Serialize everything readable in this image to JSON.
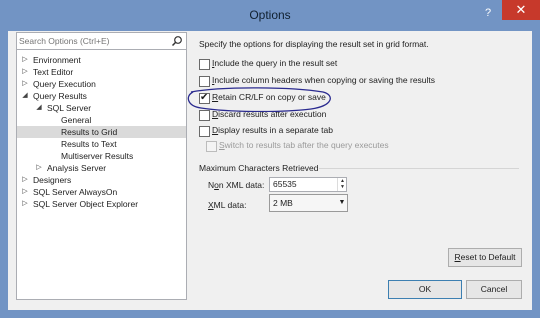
{
  "window": {
    "title": "Options",
    "help_glyph": "?",
    "close_glyph": "✕"
  },
  "search": {
    "placeholder": "Search Options (Ctrl+E)"
  },
  "tree": {
    "items": [
      {
        "label": "Environment",
        "expander": "▷"
      },
      {
        "label": "Text Editor",
        "expander": "▷"
      },
      {
        "label": "Query Execution",
        "expander": "▷"
      },
      {
        "label": "Query Results",
        "expander": "◢"
      },
      {
        "label": "SQL Server",
        "expander": "◢"
      },
      {
        "label": "General",
        "expander": ""
      },
      {
        "label": "Results to Grid",
        "expander": "",
        "selected": true
      },
      {
        "label": "Results to Text",
        "expander": ""
      },
      {
        "label": "Multiserver Results",
        "expander": ""
      },
      {
        "label": "Analysis Server",
        "expander": "▷"
      },
      {
        "label": "Designers",
        "expander": "▷"
      },
      {
        "label": "SQL Server AlwaysOn",
        "expander": "▷"
      },
      {
        "label": "SQL Server Object Explorer",
        "expander": "▷"
      }
    ]
  },
  "panel": {
    "description": "Specify the options for displaying the result set in grid format.",
    "options": [
      {
        "key": "I",
        "rest": "nclude the query in the result set",
        "checked": false,
        "enabled": true
      },
      {
        "key": "I",
        "rest": "nclude column headers when copying or saving the results",
        "checked": false,
        "enabled": true
      },
      {
        "key": "R",
        "rest": "etain CR/LF on copy or save",
        "checked": true,
        "enabled": true
      },
      {
        "key": "D",
        "rest": "iscard results after execution",
        "checked": false,
        "enabled": true
      },
      {
        "key": "D",
        "rest": "isplay results in a separate tab",
        "checked": false,
        "enabled": true
      },
      {
        "key": "S",
        "rest": "witch to results tab after the query executes",
        "checked": false,
        "enabled": false
      }
    ],
    "max_chars_group": "Maximum Characters Retrieved",
    "non_xml": {
      "pre": "N",
      "key": "o",
      "post": "n XML data:",
      "value": "65535"
    },
    "xml": {
      "pre": "",
      "key": "X",
      "post": "ML data:",
      "value": "2 MB"
    },
    "check_glyph": "✔"
  },
  "buttons": {
    "reset": {
      "key": "R",
      "rest": "eset to Default"
    },
    "ok": "OK",
    "cancel": "Cancel"
  },
  "colors": {
    "titlebar": "#7294c4",
    "close": "#c7392b",
    "annotation": "#2a2a8f"
  }
}
